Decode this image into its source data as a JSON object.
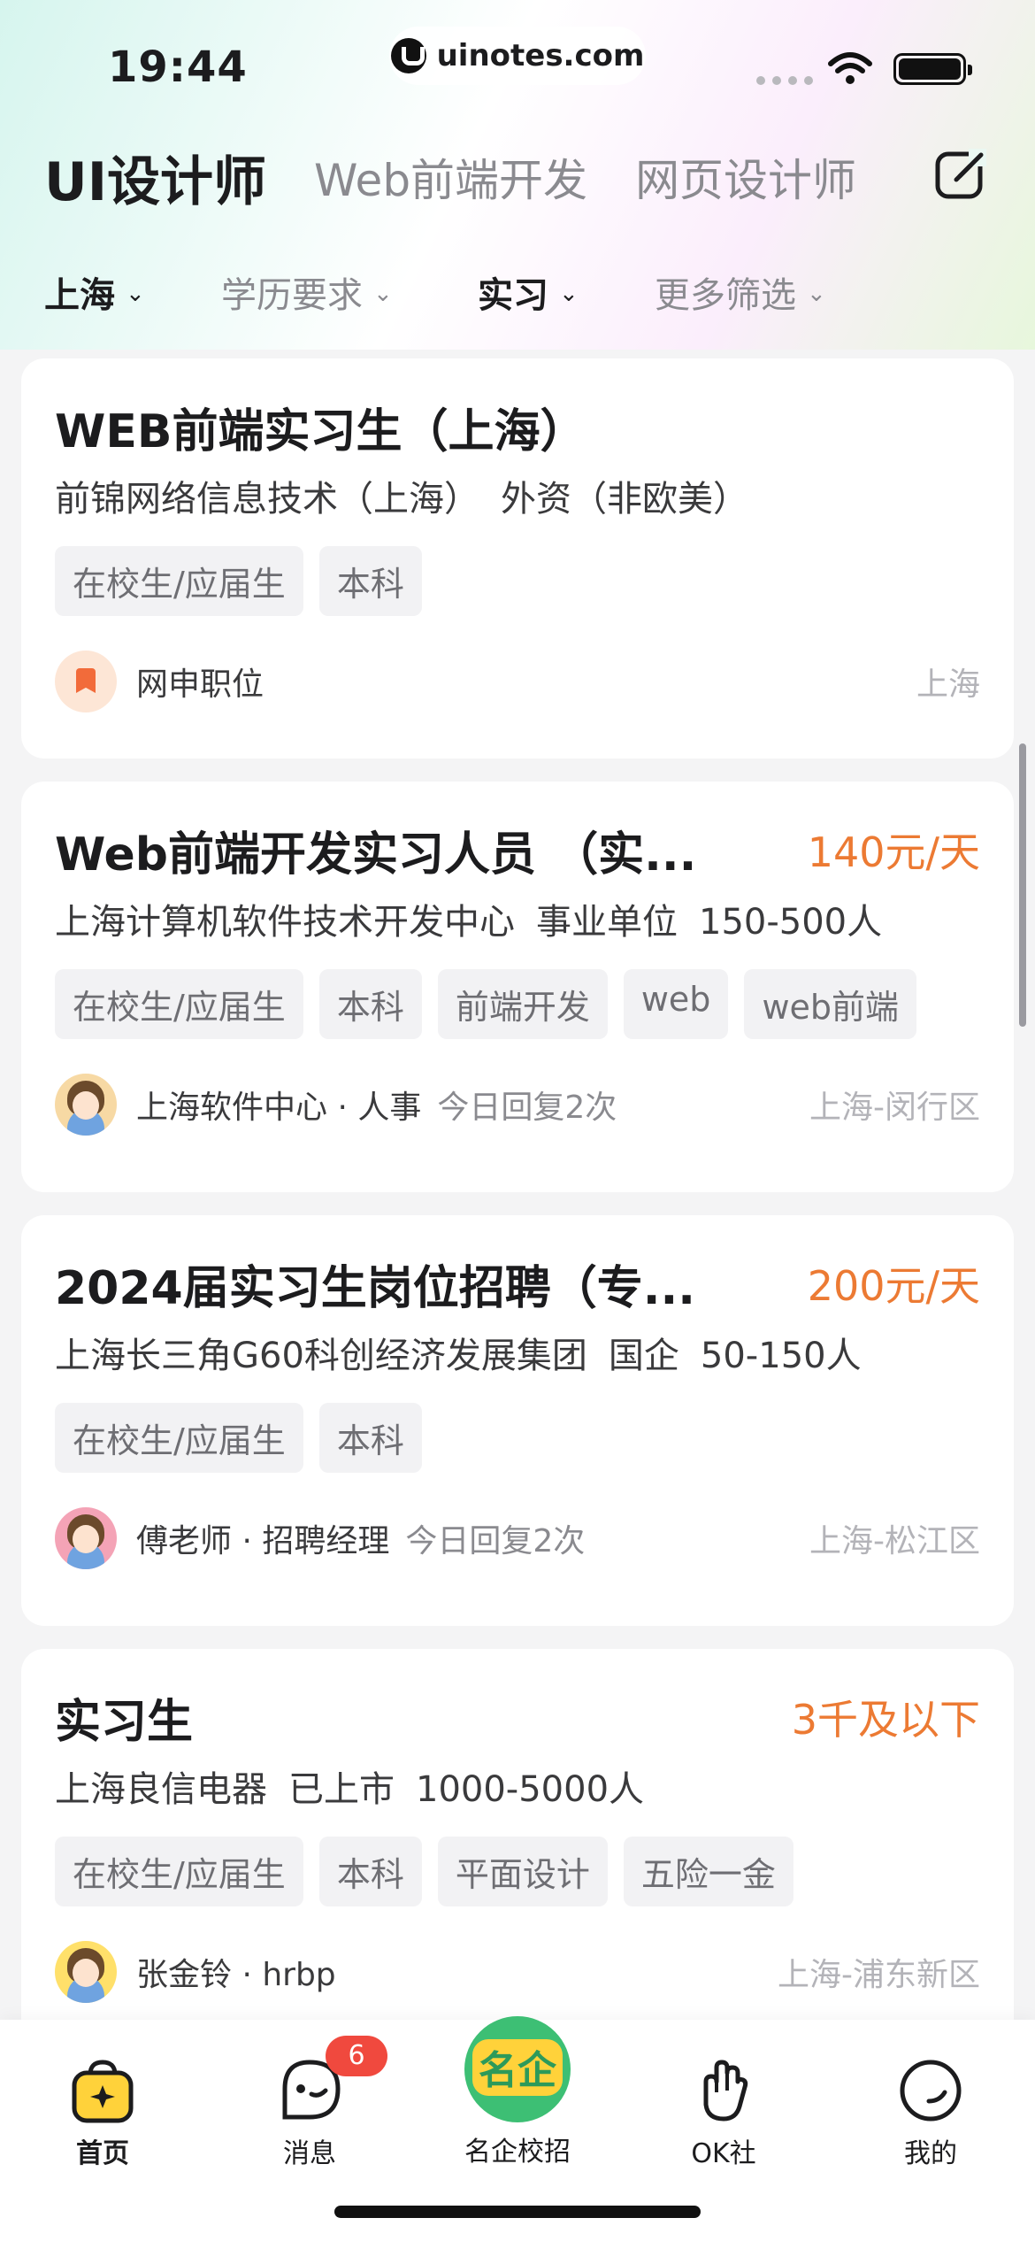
{
  "status_bar": {
    "time": "19:44",
    "url": "uinotes.com"
  },
  "header": {
    "tabs": [
      {
        "label": "UI设计师",
        "active": true
      },
      {
        "label": "Web前端开发",
        "active": false
      },
      {
        "label": "网页设计师",
        "active": false
      }
    ],
    "edit_icon": "edit-icon"
  },
  "filters": [
    {
      "label": "上海",
      "selected": true
    },
    {
      "label": "学历要求",
      "selected": false
    },
    {
      "label": "实习",
      "selected": true
    },
    {
      "label": "更多筛选",
      "selected": false
    }
  ],
  "jobs": [
    {
      "title": "WEB前端实习生（上海）",
      "salary": "",
      "company": "前锦网络信息技术（上海）",
      "company_type": "外资（非欧美）",
      "company_size": "",
      "tags": [
        "在校生/应届生",
        "本科"
      ],
      "recruiter": "网申职位",
      "reply": "",
      "location": "上海"
    },
    {
      "title": "Web前端开发实习人员 （实...",
      "salary": "140元/天",
      "company": "上海计算机软件技术开发中心",
      "company_type": "事业单位",
      "company_size": "150-500人",
      "tags": [
        "在校生/应届生",
        "本科",
        "前端开发",
        "web",
        "web前端"
      ],
      "recruiter": "上海软件中心 · 人事",
      "reply": "今日回复2次",
      "location": "上海-闵行区"
    },
    {
      "title": "2024届实习生岗位招聘（专...",
      "salary": "200元/天",
      "company": "上海长三角G60科创经济发展集团",
      "company_type": "国企",
      "company_size": "50-150人",
      "tags": [
        "在校生/应届生",
        "本科"
      ],
      "recruiter": "傅老师 · 招聘经理",
      "reply": "今日回复2次",
      "location": "上海-松江区"
    },
    {
      "title": "实习生",
      "salary": "3千及以下",
      "company": "上海良信电器",
      "company_type": "已上市",
      "company_size": "1000-5000人",
      "tags": [
        "在校生/应届生",
        "本科",
        "平面设计",
        "五险一金"
      ],
      "recruiter": "张金铃 · hrbp",
      "reply": "",
      "location": "上海-浦东新区"
    }
  ],
  "tab_bar": {
    "items": [
      {
        "label": "首页",
        "icon": "home-bag-icon",
        "active": true
      },
      {
        "label": "消息",
        "icon": "message-bubble-icon",
        "badge": "6"
      },
      {
        "label": "名企校招",
        "icon": "mingqi-logo-icon",
        "logo_text": "名企"
      },
      {
        "label": "OK社",
        "icon": "ok-hand-icon"
      },
      {
        "label": "我的",
        "icon": "smile-face-icon"
      }
    ]
  },
  "colors": {
    "accent_salary": "#ec7a33",
    "badge_red": "#f0493e",
    "brand_yellow": "#ffd23a"
  }
}
